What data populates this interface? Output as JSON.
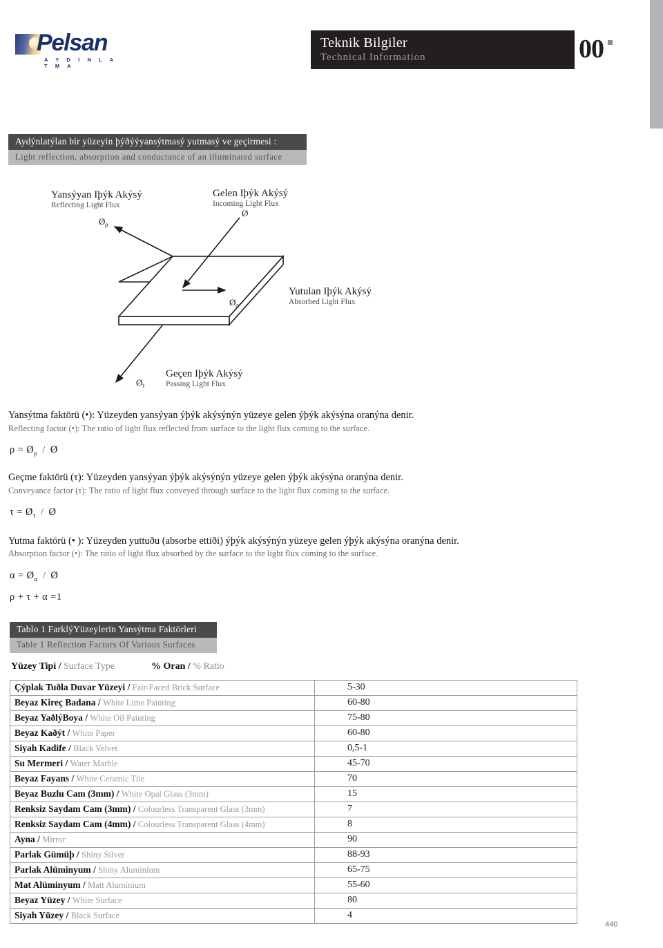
{
  "brand": {
    "name": "Pelsan",
    "tagline": "A Y D I N L A T M A",
    "logo_icon": "lightbulb-gradient-icon",
    "color": "#1b3069"
  },
  "header": {
    "title_tr": "Teknik Bilgiler",
    "title_en": "Technical Information",
    "page_code": "00",
    "box_color": "#231f20"
  },
  "section": {
    "banner_tr": "Aydýnlatýlan bir yüzeyin þýðýýyansýtmasý yutmasý ve geçirmesi :",
    "banner_en": "Light reflection, absorption and conductance of an illuminated surface",
    "banner_dark": "#4a4a4a",
    "banner_light": "#b9b9b9"
  },
  "diagram": {
    "incoming_tr": "Gelen Iþýk Akýsý",
    "incoming_en": "Incoming Light Flux",
    "incoming_sym": "Ø",
    "reflecting_tr": "Yansýyan Iþýk Akýsý",
    "reflecting_en": "Reflecting Light Flux",
    "reflecting_sym": "Ø",
    "reflecting_sub": "ρ",
    "absorbed_tr": "Yutulan Iþýk Akýsý",
    "absorbed_en": "Absorbed Light Flux",
    "absorbed_sym": "Ø",
    "absorbed_sub": "α",
    "passing_tr": "Geçen Iþýk Akýsý",
    "passing_en": "Passing Light Flux",
    "passing_sym": "Ø",
    "passing_sub": "τ"
  },
  "definitions": [
    {
      "tr": "Yansýtma faktörü (•): Yüzeyden yansýyan ýþýk akýsýnýn yüzeye gelen ýþýk akýsýna oranýna denir.",
      "en": "Reflecting factor (•): The ratio of light flux reflected from surface to the light flux coming to the surface.",
      "formula_lhs": "ρ",
      "formula_num_sym": "Ø",
      "formula_num_sub": "ρ",
      "formula_den": "Ø"
    },
    {
      "tr": "Geçme faktörü (τ): Yüzeyden yansýyan ýþýk akýsýnýn yüzeye gelen ýþýk akýsýna oranýna denir.",
      "en": "Conveyance factor (τ): The ratio of light flux conveyed through surface to the light flux coming to the surface.",
      "formula_lhs": "τ",
      "formula_num_sym": "Ø",
      "formula_num_sub": "τ",
      "formula_den": "Ø"
    },
    {
      "tr": "Yutma faktörü (• ): Yüzeyden yuttuðu (absorbe ettiði) ýþýk akýsýnýn yüzeye gelen ýþýk akýsýna oranýna denir.",
      "en": "Absorption factor (•): The ratio of light flux absorbed by the surface to the light flux coming to the surface.",
      "formula_lhs": "α",
      "formula_num_sym": "Ø",
      "formula_num_sub": "α",
      "formula_den": "Ø"
    }
  ],
  "sum_formula": "ρ + τ + α =1",
  "table": {
    "banner_tr": "Tablo 1 FarklýYüzeylerin Yansýtma Faktörleri",
    "banner_en": "Table 1 Reflection Factors Of Various Surfaces",
    "col1_tr": "Yüzey Tipi /",
    "col1_en": "Surface Type",
    "col2_tr": "% Oran /",
    "col2_en": "% Ratio",
    "rows": [
      {
        "tr": "Çýplak Tuðla Duvar Yüzeyi",
        "en": "Fair-Faced Brick Surface",
        "value": "5-30"
      },
      {
        "tr": "Beyaz Kireç Badana",
        "en": "White Lime Painting",
        "value": "60-80"
      },
      {
        "tr": "Beyaz YaðlýBoya",
        "en": "White Oil Painting",
        "value": "75-80"
      },
      {
        "tr": "Beyaz Kaðýt",
        "en": "White Paper",
        "value": "60-80"
      },
      {
        "tr": "Siyah Kadife",
        "en": "Black Velvet",
        "value": "0,5-1"
      },
      {
        "tr": "Su Mermeri",
        "en": "Water Marble",
        "value": "45-70"
      },
      {
        "tr": "Beyaz Fayans",
        "en": "White Ceramic Tile",
        "value": "70"
      },
      {
        "tr": "Beyaz Buzlu Cam (3mm)",
        "en": "White Opal Glass (3mm)",
        "value": "15"
      },
      {
        "tr": "Renksiz Saydam Cam (3mm)",
        "en": "Colourless Transparent Glass (3mm)",
        "value": "7"
      },
      {
        "tr": "Renksiz Saydam Cam (4mm)",
        "en": "Colourless Transparent Glass (4mm)",
        "value": "8"
      },
      {
        "tr": "Ayna",
        "en": "Mirror",
        "value": "90"
      },
      {
        "tr": "Parlak Gümüþ",
        "en": "Shiny Silver",
        "value": "88-93"
      },
      {
        "tr": "Parlak Alüminyum",
        "en": "Shiny Aluminium",
        "value": "65-75"
      },
      {
        "tr": "Mat Alüminyum",
        "en": "Matt Aluminium",
        "value": "55-60"
      },
      {
        "tr": "Beyaz Yüzey",
        "en": "White Surface",
        "value": "80"
      },
      {
        "tr": "Siyah Yüzey",
        "en": "Black Surface",
        "value": "4"
      }
    ]
  },
  "footer": {
    "folio": "440"
  }
}
